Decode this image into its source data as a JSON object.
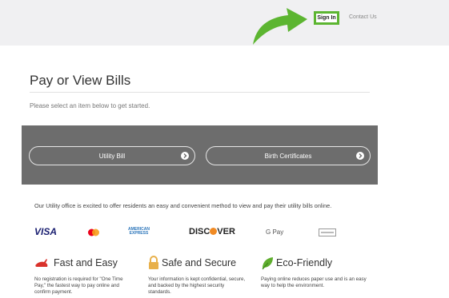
{
  "header": {
    "sign_in_label": "Sign In",
    "contact_label": "Contact Us"
  },
  "main": {
    "title": "Pay or View Bills",
    "instructions": "Please select an item below to get started.",
    "options": [
      {
        "label": "Utility Bill"
      },
      {
        "label": "Birth Certificates"
      }
    ],
    "office_text": "Our Utility office is excited to offer residents an easy and convenient method to view and pay their utility bills online."
  },
  "payment_logos": {
    "visa": "VISA",
    "amex_line1": "AMERICAN",
    "amex_line2": "EXPRESS",
    "discover_pre": "DISC",
    "discover_post": "VER",
    "gpay": "G Pay"
  },
  "features": [
    {
      "title": "Fast and Easy",
      "text": "No registration is required for \"One Time Pay,\" the fastest way to pay online and confirm payment."
    },
    {
      "title": "Safe and Secure",
      "text": "Your information is kept confidential, secure, and backed by the highest security standards."
    },
    {
      "title": "Eco-Friendly",
      "text": "Paying online reduces paper use and is an easy way to help the environment."
    }
  ],
  "colors": {
    "highlight_green": "#5cb531",
    "banner_gray": "#6d6d6d",
    "topbar_bg": "#f0f0f2",
    "visa_blue": "#1a1f71",
    "amex_blue": "#2e77bb",
    "discover_orange": "#f08a24",
    "rabbit_red": "#d9322b",
    "lock_gold": "#e8b04a",
    "leaf_green": "#5fae2e"
  },
  "icons": [
    "green-arrow-icon",
    "chevron-right-icon",
    "mastercard-icon",
    "generic-card-icon",
    "rabbit-icon",
    "lock-icon",
    "leaf-icon"
  ]
}
